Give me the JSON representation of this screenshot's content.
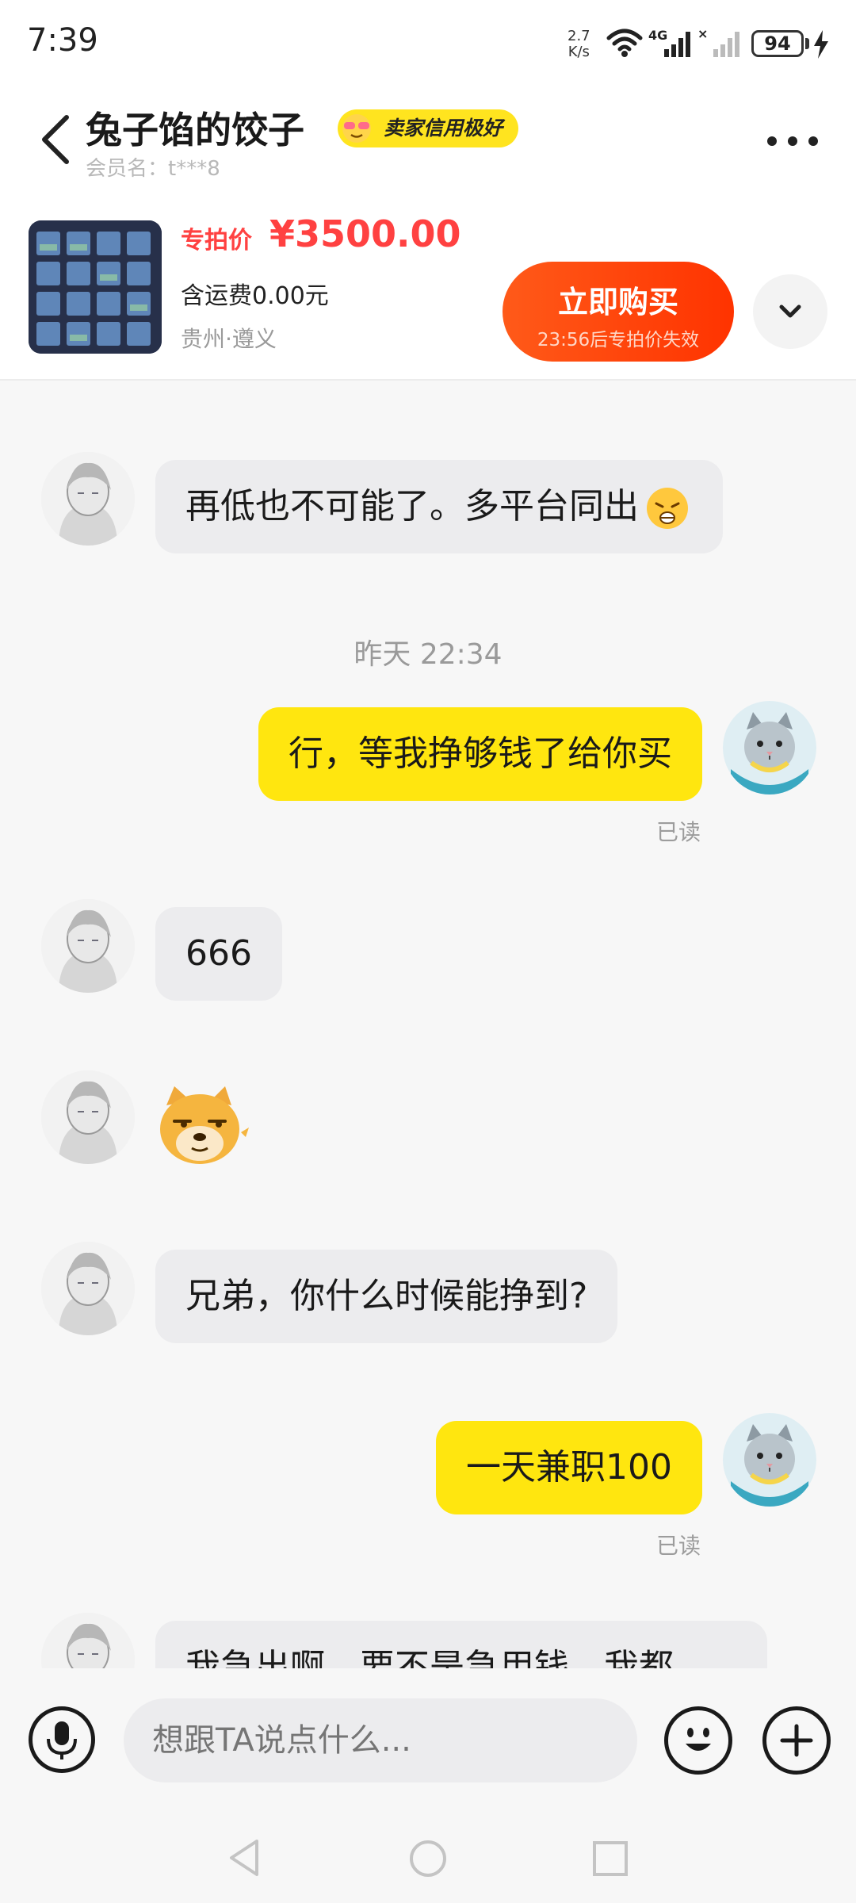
{
  "status_bar": {
    "time": "7:39",
    "net_speed_value": "2.7",
    "net_speed_unit": "K/s",
    "battery": "94"
  },
  "header": {
    "title": "兔子馅的饺子",
    "badge": "卖家信用极好",
    "member": "会员名：t***8"
  },
  "product": {
    "price_label": "专拍价",
    "price": "¥3500.00",
    "shipping": "含运费0.00元",
    "location": "贵州·遵义",
    "buy_label": "立即购买",
    "buy_sub": "23:56后专拍价失效"
  },
  "messages": {
    "m1": "再低也不可能了。多平台同出",
    "timestamp": "昨天 22:34",
    "m2": "行，等我挣够钱了给你买",
    "m2_status": "已读",
    "m3": "666",
    "m5": "兄弟，你什么时候能挣到?",
    "m6": "一天兼职100",
    "m6_status": "已读",
    "m7": "我急出啊，要不是急用钱，我都"
  },
  "input": {
    "placeholder": "想跟TA说点什么..."
  },
  "colors": {
    "accent_yellow": "#ffe60f",
    "price_red": "#ff4141",
    "buy_orange": "#ff3300"
  },
  "icons": [
    "back-icon",
    "more-icon",
    "chevron-down-icon",
    "mic-icon",
    "emoji-icon",
    "plus-icon",
    "nav-back-icon",
    "nav-home-icon",
    "nav-recents-icon"
  ]
}
